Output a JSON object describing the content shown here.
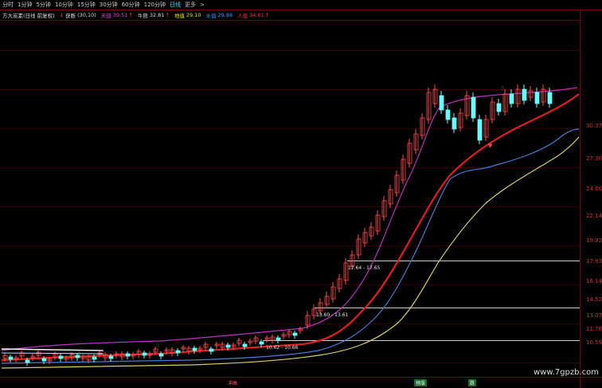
{
  "toolbar": {
    "periods": [
      "分时",
      "1分钟",
      "5分钟",
      "10分钟",
      "15分钟",
      "30分钟",
      "60分钟",
      "120分钟",
      "日线",
      "更多"
    ],
    "active_index": 8,
    "more_chevron": ">"
  },
  "infobar": {
    "indicator_title": "方大炭素(日线 前复权)",
    "items": [
      {
        "label": "获断",
        "value": "(30,10)",
        "color": "#dddddd"
      },
      {
        "label": "天值",
        "value": "39.51",
        "color": "#e040e0"
      },
      {
        "label": "牛熊",
        "value": "32.81",
        "color": "#dddddd"
      },
      {
        "label": "地值",
        "value": "29.10",
        "color": "#e6e600"
      },
      {
        "label": "水值",
        "value": "29.88",
        "color": "#3399ff"
      },
      {
        "label": "人值",
        "value": "34.61",
        "color": "#ff3333"
      }
    ]
  },
  "y_axis": {
    "labels": [
      "30.37",
      "27.30",
      "24.60",
      "22.14",
      "19.92",
      "17.93",
      "16.14",
      "14.52",
      "13.07",
      "11.76",
      "10.59"
    ]
  },
  "annotations": {
    "level1": "17.64 - 17.65",
    "level2": "13.60 - 13.61",
    "level3": "10.62 - 10.66"
  },
  "bottom_tags": {
    "tag1": "冲高",
    "tag2": "预涨",
    "tag3": "跌"
  },
  "watermark": "www.7gpzb.com",
  "colors": {
    "up": "#ff4d4d",
    "down": "#66ffff",
    "ma_red": "#e02020",
    "ma_blue": "#4a7bd4",
    "ma_yellow": "#d8d060",
    "ma_magenta": "#c030c0",
    "grid": "#3a0000"
  }
}
